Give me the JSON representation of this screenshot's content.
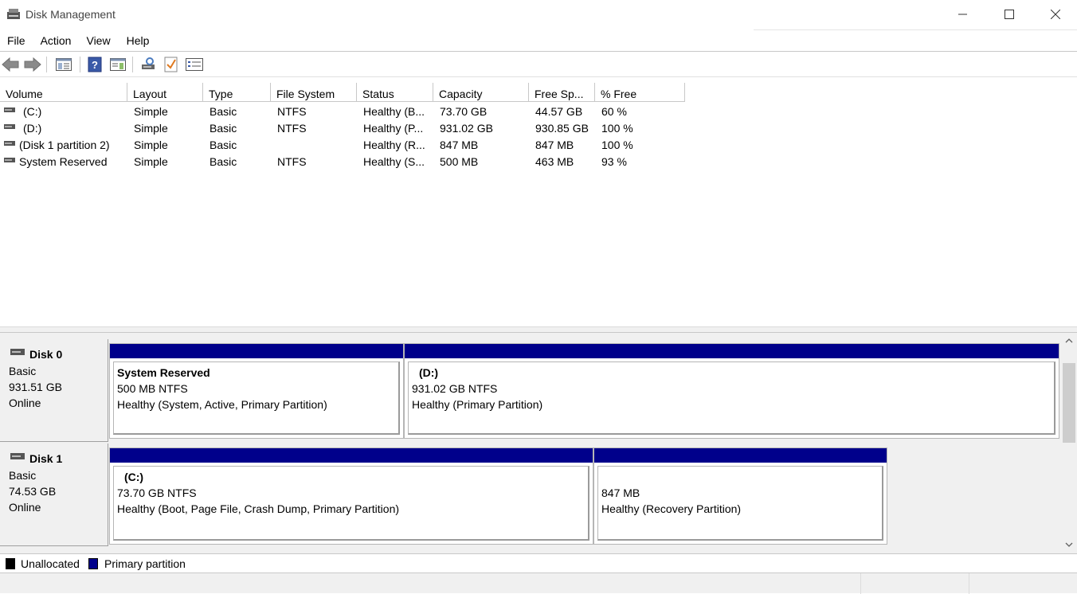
{
  "window": {
    "title": "Disk Management"
  },
  "menu": [
    "File",
    "Action",
    "View",
    "Help"
  ],
  "toolbar": {
    "icons": [
      "back-arrow-icon",
      "forward-arrow-icon",
      "console-tree-icon",
      "help-icon",
      "properties-panel-icon",
      "connect-disk-icon",
      "check-icon",
      "list-view-icon"
    ]
  },
  "volume_list": {
    "columns": [
      "Volume",
      "Layout",
      "Type",
      "File System",
      "Status",
      "Capacity",
      "Free Sp...",
      "% Free"
    ],
    "rows": [
      {
        "volume": "(C:)",
        "layout": "Simple",
        "type": "Basic",
        "fs": "NTFS",
        "status": "Healthy (B...",
        "capacity": "73.70 GB",
        "free": "44.57 GB",
        "pct": "60 %"
      },
      {
        "volume": "(D:)",
        "layout": "Simple",
        "type": "Basic",
        "fs": "NTFS",
        "status": "Healthy (P...",
        "capacity": "931.02 GB",
        "free": "930.85 GB",
        "pct": "100 %"
      },
      {
        "volume": "(Disk 1 partition 2)",
        "layout": "Simple",
        "type": "Basic",
        "fs": "",
        "status": "Healthy (R...",
        "capacity": "847 MB",
        "free": "847 MB",
        "pct": "100 %"
      },
      {
        "volume": "System Reserved",
        "layout": "Simple",
        "type": "Basic",
        "fs": "NTFS",
        "status": "Healthy (S...",
        "capacity": "500 MB",
        "free": "463 MB",
        "pct": "93 %"
      }
    ]
  },
  "disks": [
    {
      "name": "Disk 0",
      "type": "Basic",
      "size": "931.51 GB",
      "state": "Online",
      "partitions": [
        {
          "name": "System Reserved",
          "size_fs": "500 MB NTFS",
          "status": "Healthy (System, Active, Primary Partition)"
        },
        {
          "name": "(D:)",
          "size_fs": "931.02 GB NTFS",
          "status": "Healthy (Primary Partition)"
        }
      ]
    },
    {
      "name": "Disk 1",
      "type": "Basic",
      "size": "74.53 GB",
      "state": "Online",
      "partitions": [
        {
          "name": "(C:)",
          "size_fs": "73.70 GB NTFS",
          "status": "Healthy (Boot, Page File, Crash Dump, Primary Partition)"
        },
        {
          "name": "",
          "size_fs": "847 MB",
          "status": "Healthy (Recovery Partition)"
        }
      ]
    }
  ],
  "legend": [
    {
      "label": "Unallocated",
      "color": "#000000"
    },
    {
      "label": "Primary partition",
      "color": "#00008b"
    }
  ],
  "colors": {
    "primary_partition": "#00008b",
    "unallocated": "#000000"
  }
}
